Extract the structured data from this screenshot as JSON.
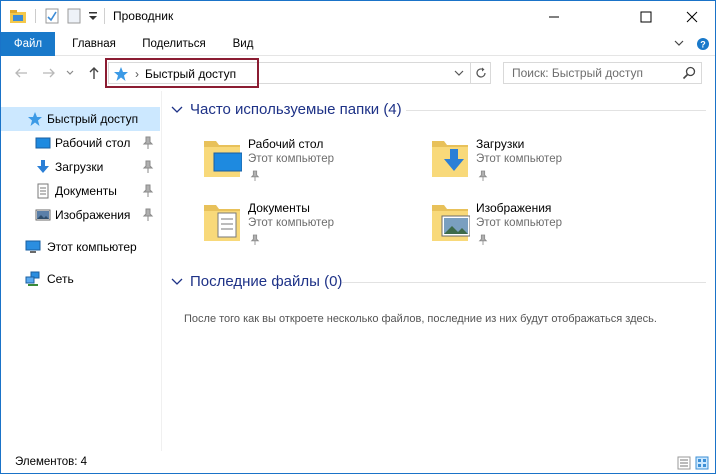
{
  "window": {
    "title": "Проводник",
    "controls": {
      "minimize": "—",
      "maximize": "☐",
      "close": "✕"
    }
  },
  "ribbon": {
    "tabs": [
      "Файл",
      "Главная",
      "Поделиться",
      "Вид"
    ],
    "collapse_glyph": "∨",
    "help_glyph": "?"
  },
  "address": {
    "path_label": "Быстрый доступ",
    "separator": "›",
    "search_placeholder": "Поиск: Быстрый доступ"
  },
  "nav": {
    "items": [
      {
        "label": "Быстрый доступ",
        "icon": "star-icon",
        "selected": true
      },
      {
        "label": "Рабочий стол",
        "icon": "desktop-icon",
        "pinned": true
      },
      {
        "label": "Загрузки",
        "icon": "download-icon",
        "pinned": true
      },
      {
        "label": "Документы",
        "icon": "documents-icon",
        "pinned": true
      },
      {
        "label": "Изображения",
        "icon": "pictures-icon",
        "pinned": true
      },
      {
        "label": "Этот компьютер",
        "icon": "computer-icon"
      },
      {
        "label": "Сеть",
        "icon": "network-icon"
      }
    ]
  },
  "groups": {
    "frequent": {
      "title": "Часто используемые папки (4)",
      "folders": [
        {
          "name": "Рабочий стол",
          "location": "Этот компьютер",
          "icon": "desktop-folder-icon"
        },
        {
          "name": "Загрузки",
          "location": "Этот компьютер",
          "icon": "downloads-folder-icon"
        },
        {
          "name": "Документы",
          "location": "Этот компьютер",
          "icon": "documents-folder-icon"
        },
        {
          "name": "Изображения",
          "location": "Этот компьютер",
          "icon": "pictures-folder-icon"
        }
      ]
    },
    "recent": {
      "title": "Последние файлы (0)",
      "empty_message": "После того как вы откроете несколько файлов, последние из них будут отображаться здесь."
    }
  },
  "status": {
    "items_count": "Элементов: 4"
  },
  "colors": {
    "accent": "#1979ca",
    "selection": "#cce8ff",
    "group_header": "#1e3287",
    "highlight_box": "#8b1c32"
  }
}
